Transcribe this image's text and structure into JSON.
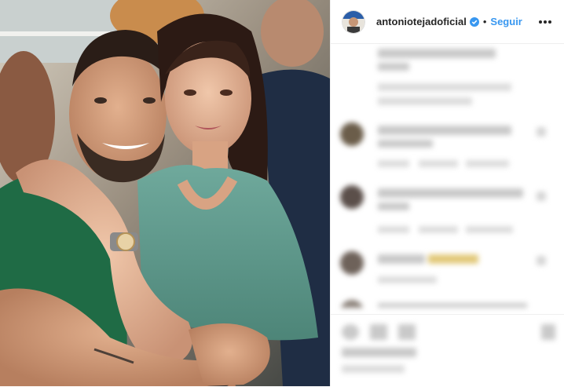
{
  "post": {
    "username": "antoniotejadoficial",
    "separator": "•",
    "follow_label": "Seguir",
    "verified_color": "#3897f0",
    "more_icon": "more-horizontal-icon",
    "photo": {
      "icon": "photo-couple",
      "subject": "man in green shirt hugging young woman in teal top"
    },
    "comments_obscured": true
  }
}
